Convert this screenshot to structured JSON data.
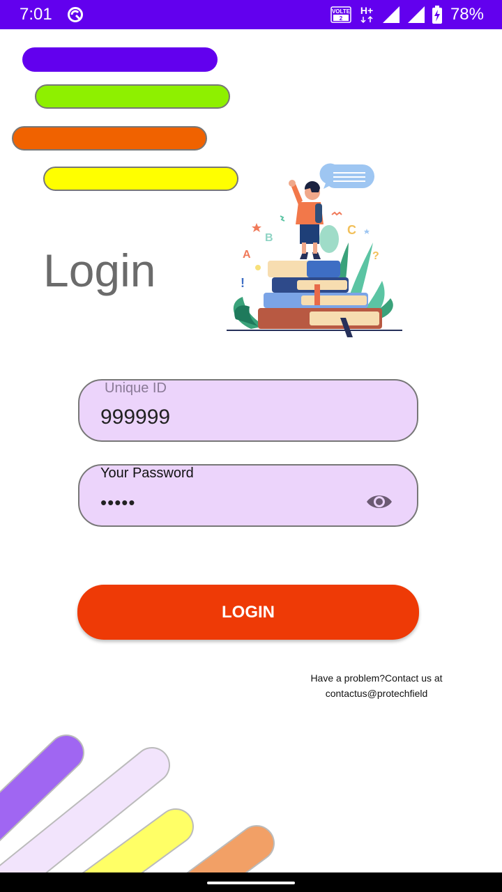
{
  "status_bar": {
    "time": "7:01",
    "volte_label": "VOLTE",
    "volte_sim": "2",
    "network_type": "H+",
    "battery_percent": "78%",
    "background_color": "#6200ee"
  },
  "decor": {
    "top_pill_colors": [
      "#6200ee",
      "#8ef000",
      "#f06200",
      "#ffff00"
    ],
    "bottom_stripe_colors": [
      "#a066f2",
      "#f2e4fc",
      "#ffff66",
      "#f2a066"
    ]
  },
  "page": {
    "title": "Login"
  },
  "form": {
    "unique_id": {
      "label": "Unique ID",
      "value": "999999"
    },
    "password": {
      "label": "Your Password",
      "value": "•••••"
    },
    "field_background": "#ecd4fb"
  },
  "login_button": {
    "label": "LOGIN",
    "color": "#ee3a06"
  },
  "help": {
    "line1": "Have a problem?Contact us at",
    "line2": "contactus@protechfield"
  },
  "icons": {
    "sync": "sync-status-icon",
    "volte": "volte-icon",
    "signal": "signal-icon",
    "battery": "battery-charging-icon",
    "password_visibility": "eye-icon"
  }
}
